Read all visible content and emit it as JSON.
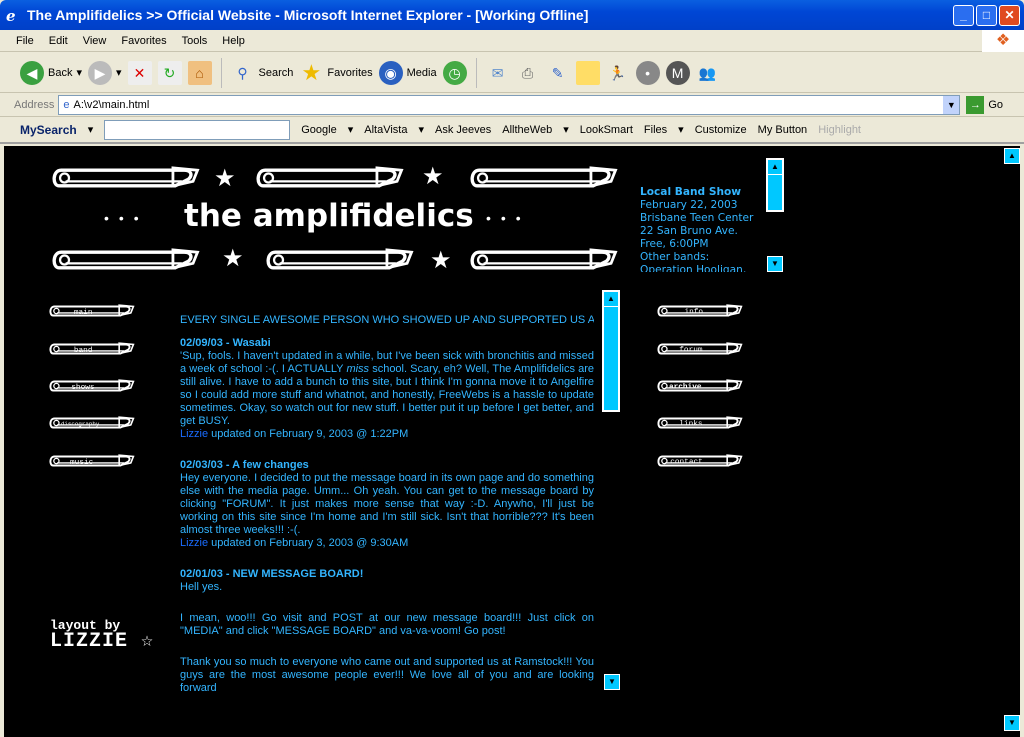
{
  "window": {
    "title": "The Amplifidelics >> Official Website - Microsoft Internet Explorer - [Working Offline]"
  },
  "menu": [
    "File",
    "Edit",
    "View",
    "Favorites",
    "Tools",
    "Help"
  ],
  "toolbar": {
    "back": "Back",
    "search": "Search",
    "favorites": "Favorites",
    "media": "Media"
  },
  "address": {
    "label": "Address",
    "value": "A:\\v2\\main.html",
    "go": "Go"
  },
  "links_bar": {
    "mysearch": "MySearch",
    "google": "Google",
    "altavista": "AltaVista",
    "askjeeves": "Ask Jeeves",
    "alltheweb": "AlltheWeb",
    "looksmart": "LookSmart",
    "files": "Files",
    "customize": "Customize",
    "mybutton": "My Button",
    "highlight": "Highlight"
  },
  "site": {
    "title": "the amplifidelics",
    "nav_left": [
      "main",
      "band",
      "shows",
      "discography",
      "music"
    ],
    "nav_right": [
      "info",
      "forum",
      "archive",
      "links",
      "contact"
    ],
    "credit": {
      "line1": "layout by",
      "line2": "LIZZIE"
    },
    "event": {
      "title": "Local Band Show",
      "lines": [
        "February 22, 2003",
        "Brisbane Teen Center",
        "22 San Bruno Ave.",
        "Free, 6:00PM",
        "Other bands: Operation Hooligan, more TBA"
      ]
    },
    "marquee": "EVERY SINGLE AWESOME PERSON WHO SHOWED UP AND SUPPORTED US AT RAMST",
    "posts": [
      {
        "title": "02/09/03 - Wasabi",
        "body_a": "'Sup, fools. I haven't updated in a while, but I've been sick with bronchitis and missed a week of school :-(. I ACTUALLY ",
        "body_em": "miss",
        "body_b": " school. Scary, eh? Well, The Amplifidelics are still alive. I have to add a bunch to this site, but I think I'm gonna move it to Angelfire so I could add more stuff and whatnot, and honestly, FreeWebs is a hassle to update sometimes. Okay, so watch out for new stuff. I better put it up before I get better, and get BUSY.",
        "author": "Lizzie",
        "updated": " updated on February 9, 2003 @ 1:22PM"
      },
      {
        "title": "02/03/03 - A few changes",
        "body": "Hey everyone. I decided to put the message board in its own page and do something else with the media page. Umm... Oh yeah. You can get to the message board by clicking \"FORUM\". It just makes more sense that way :-D. Anywho, I'll just be working on this site since I'm home and I'm still sick. Isn't that horrible??? It's been almost three weeks!!! :-(.",
        "author": "Lizzie",
        "updated": " updated on February 3, 2003 @ 9:30AM"
      },
      {
        "title": "02/01/03 - NEW MESSAGE BOARD!",
        "p1": "Hell yes.",
        "p2": "I mean, woo!!! Go visit and POST at our new message board!!! Just click on \"MEDIA\" and click \"MESSAGE BOARD\" and va-va-voom! Go post!",
        "p3": "Thank you so much to everyone who came out and supported us at Ramstock!!! You guys are the most awesome people ever!!! We love all of you and are looking forward"
      }
    ]
  }
}
